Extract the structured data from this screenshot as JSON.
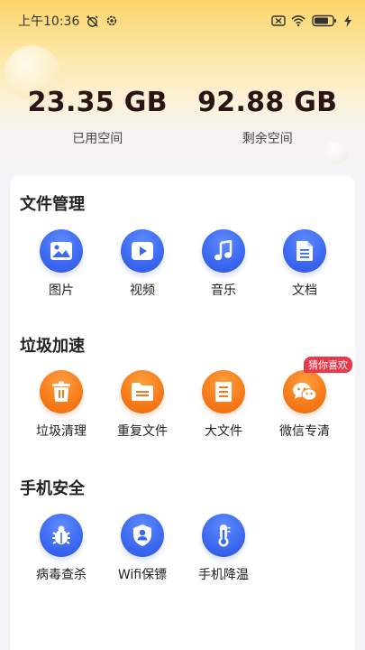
{
  "status_bar": {
    "time": "上午10:36",
    "battery": ""
  },
  "storage": {
    "used": {
      "value": "23.35 GB",
      "label": "已用空间"
    },
    "free": {
      "value": "92.88 GB",
      "label": "剩余空间"
    }
  },
  "sections": {
    "file_management": {
      "title": "文件管理",
      "items": [
        {
          "label": "图片",
          "icon": "image-icon"
        },
        {
          "label": "视频",
          "icon": "video-icon"
        },
        {
          "label": "音乐",
          "icon": "music-icon"
        },
        {
          "label": "文档",
          "icon": "document-icon"
        }
      ]
    },
    "junk_speedup": {
      "title": "垃圾加速",
      "items": [
        {
          "label": "垃圾清理",
          "icon": "trash-icon"
        },
        {
          "label": "重复文件",
          "icon": "duplicate-folder-icon"
        },
        {
          "label": "大文件",
          "icon": "large-file-icon"
        },
        {
          "label": "微信专清",
          "icon": "wechat-icon",
          "badge": "猜你喜欢"
        }
      ]
    },
    "phone_security": {
      "title": "手机安全",
      "items": [
        {
          "label": "病毒查杀",
          "icon": "bug-icon"
        },
        {
          "label": "Wifi保镖",
          "icon": "shield-user-icon"
        },
        {
          "label": "手机降温",
          "icon": "thermometer-icon"
        }
      ]
    }
  },
  "colors": {
    "blue": "#3b68f0",
    "orange": "#f57a18",
    "badge": "#e8384a",
    "header": "#fcd56b"
  }
}
